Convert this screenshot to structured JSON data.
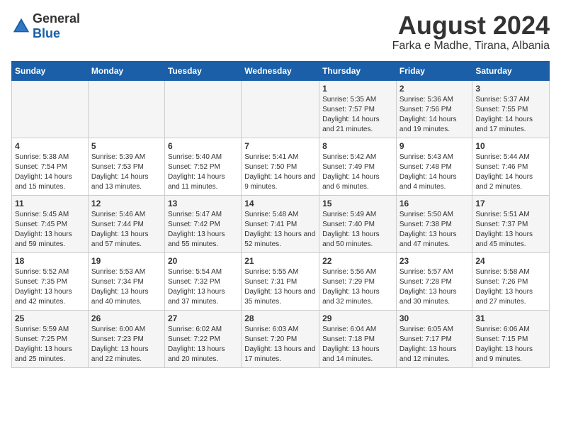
{
  "header": {
    "logo_general": "General",
    "logo_blue": "Blue",
    "title": "August 2024",
    "subtitle": "Farka e Madhe, Tirana, Albania"
  },
  "days_of_week": [
    "Sunday",
    "Monday",
    "Tuesday",
    "Wednesday",
    "Thursday",
    "Friday",
    "Saturday"
  ],
  "weeks": [
    {
      "days": [
        {
          "num": "",
          "info": ""
        },
        {
          "num": "",
          "info": ""
        },
        {
          "num": "",
          "info": ""
        },
        {
          "num": "",
          "info": ""
        },
        {
          "num": "1",
          "info": "Sunrise: 5:35 AM\nSunset: 7:57 PM\nDaylight: 14 hours\nand 21 minutes."
        },
        {
          "num": "2",
          "info": "Sunrise: 5:36 AM\nSunset: 7:56 PM\nDaylight: 14 hours\nand 19 minutes."
        },
        {
          "num": "3",
          "info": "Sunrise: 5:37 AM\nSunset: 7:55 PM\nDaylight: 14 hours\nand 17 minutes."
        }
      ]
    },
    {
      "days": [
        {
          "num": "4",
          "info": "Sunrise: 5:38 AM\nSunset: 7:54 PM\nDaylight: 14 hours\nand 15 minutes."
        },
        {
          "num": "5",
          "info": "Sunrise: 5:39 AM\nSunset: 7:53 PM\nDaylight: 14 hours\nand 13 minutes."
        },
        {
          "num": "6",
          "info": "Sunrise: 5:40 AM\nSunset: 7:52 PM\nDaylight: 14 hours\nand 11 minutes."
        },
        {
          "num": "7",
          "info": "Sunrise: 5:41 AM\nSunset: 7:50 PM\nDaylight: 14 hours\nand 9 minutes."
        },
        {
          "num": "8",
          "info": "Sunrise: 5:42 AM\nSunset: 7:49 PM\nDaylight: 14 hours\nand 6 minutes."
        },
        {
          "num": "9",
          "info": "Sunrise: 5:43 AM\nSunset: 7:48 PM\nDaylight: 14 hours\nand 4 minutes."
        },
        {
          "num": "10",
          "info": "Sunrise: 5:44 AM\nSunset: 7:46 PM\nDaylight: 14 hours\nand 2 minutes."
        }
      ]
    },
    {
      "days": [
        {
          "num": "11",
          "info": "Sunrise: 5:45 AM\nSunset: 7:45 PM\nDaylight: 13 hours\nand 59 minutes."
        },
        {
          "num": "12",
          "info": "Sunrise: 5:46 AM\nSunset: 7:44 PM\nDaylight: 13 hours\nand 57 minutes."
        },
        {
          "num": "13",
          "info": "Sunrise: 5:47 AM\nSunset: 7:42 PM\nDaylight: 13 hours\nand 55 minutes."
        },
        {
          "num": "14",
          "info": "Sunrise: 5:48 AM\nSunset: 7:41 PM\nDaylight: 13 hours\nand 52 minutes."
        },
        {
          "num": "15",
          "info": "Sunrise: 5:49 AM\nSunset: 7:40 PM\nDaylight: 13 hours\nand 50 minutes."
        },
        {
          "num": "16",
          "info": "Sunrise: 5:50 AM\nSunset: 7:38 PM\nDaylight: 13 hours\nand 47 minutes."
        },
        {
          "num": "17",
          "info": "Sunrise: 5:51 AM\nSunset: 7:37 PM\nDaylight: 13 hours\nand 45 minutes."
        }
      ]
    },
    {
      "days": [
        {
          "num": "18",
          "info": "Sunrise: 5:52 AM\nSunset: 7:35 PM\nDaylight: 13 hours\nand 42 minutes."
        },
        {
          "num": "19",
          "info": "Sunrise: 5:53 AM\nSunset: 7:34 PM\nDaylight: 13 hours\nand 40 minutes."
        },
        {
          "num": "20",
          "info": "Sunrise: 5:54 AM\nSunset: 7:32 PM\nDaylight: 13 hours\nand 37 minutes."
        },
        {
          "num": "21",
          "info": "Sunrise: 5:55 AM\nSunset: 7:31 PM\nDaylight: 13 hours\nand 35 minutes."
        },
        {
          "num": "22",
          "info": "Sunrise: 5:56 AM\nSunset: 7:29 PM\nDaylight: 13 hours\nand 32 minutes."
        },
        {
          "num": "23",
          "info": "Sunrise: 5:57 AM\nSunset: 7:28 PM\nDaylight: 13 hours\nand 30 minutes."
        },
        {
          "num": "24",
          "info": "Sunrise: 5:58 AM\nSunset: 7:26 PM\nDaylight: 13 hours\nand 27 minutes."
        }
      ]
    },
    {
      "days": [
        {
          "num": "25",
          "info": "Sunrise: 5:59 AM\nSunset: 7:25 PM\nDaylight: 13 hours\nand 25 minutes."
        },
        {
          "num": "26",
          "info": "Sunrise: 6:00 AM\nSunset: 7:23 PM\nDaylight: 13 hours\nand 22 minutes."
        },
        {
          "num": "27",
          "info": "Sunrise: 6:02 AM\nSunset: 7:22 PM\nDaylight: 13 hours\nand 20 minutes."
        },
        {
          "num": "28",
          "info": "Sunrise: 6:03 AM\nSunset: 7:20 PM\nDaylight: 13 hours\nand 17 minutes."
        },
        {
          "num": "29",
          "info": "Sunrise: 6:04 AM\nSunset: 7:18 PM\nDaylight: 13 hours\nand 14 minutes."
        },
        {
          "num": "30",
          "info": "Sunrise: 6:05 AM\nSunset: 7:17 PM\nDaylight: 13 hours\nand 12 minutes."
        },
        {
          "num": "31",
          "info": "Sunrise: 6:06 AM\nSunset: 7:15 PM\nDaylight: 13 hours\nand 9 minutes."
        }
      ]
    }
  ]
}
